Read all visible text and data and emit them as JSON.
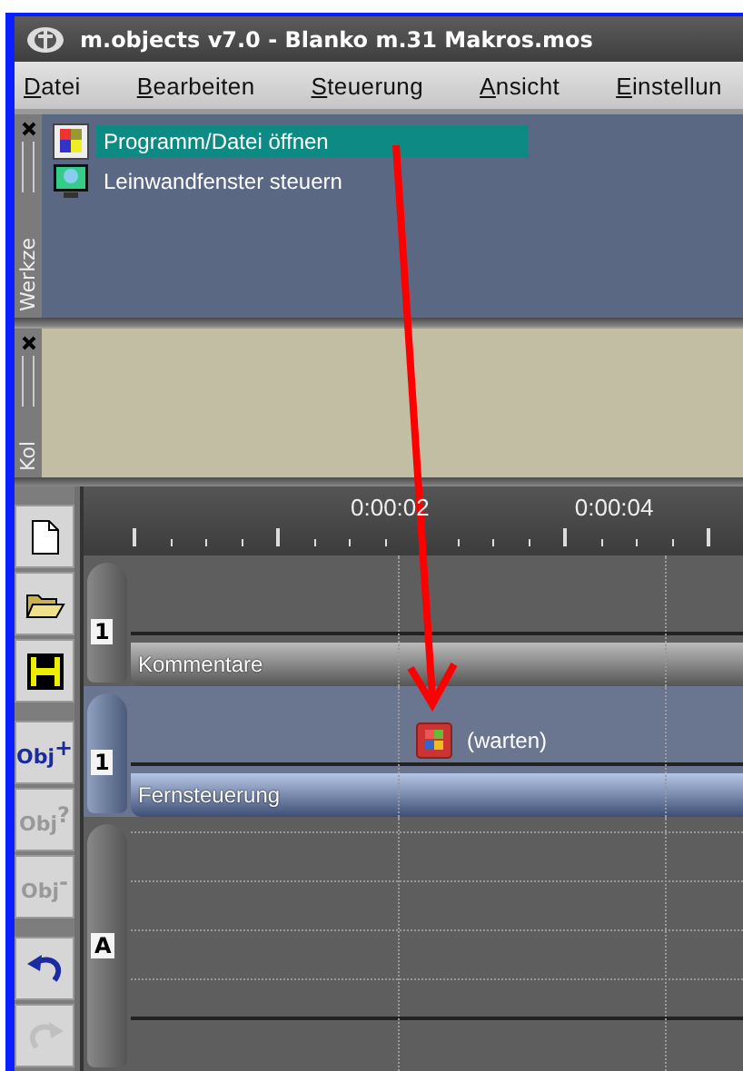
{
  "window": {
    "title": "m.objects v7.0 - Blanko m.31 Makros.mos"
  },
  "menu": [
    "Datei",
    "Bearbeiten",
    "Steuerung",
    "Ansicht",
    "Einstellun"
  ],
  "panels": [
    {
      "kind": "tools",
      "title": "Werkze",
      "items": [
        {
          "label": "Programm/Datei öffnen",
          "selected": true
        },
        {
          "label": "Leinwandfenster steuern",
          "selected": false
        }
      ]
    },
    {
      "kind": "empty",
      "title": "Kol"
    }
  ],
  "toolbar": [
    {
      "kind": "new",
      "disabled": false
    },
    {
      "kind": "open",
      "disabled": false
    },
    {
      "kind": "save",
      "disabled": false
    },
    {
      "kind": "obj",
      "label": "Obj",
      "mark": "+",
      "disabled": false
    },
    {
      "kind": "obj",
      "label": "Obj",
      "mark": "?",
      "disabled": true
    },
    {
      "kind": "obj",
      "label": "Obj",
      "mark": "-",
      "disabled": true
    },
    {
      "kind": "undo",
      "disabled": false
    },
    {
      "kind": "redo",
      "disabled": true
    }
  ],
  "ruler": {
    "labels": [
      "0:00:02",
      "0:00:04"
    ]
  },
  "tracks": [
    {
      "number": "1",
      "name": "Kommentare",
      "selected": false
    },
    {
      "number": "1",
      "name": "Fernsteuerung",
      "selected": true,
      "cues": [
        {
          "label": "(warten)"
        }
      ]
    },
    {
      "number": "A",
      "selected": false
    }
  ]
}
